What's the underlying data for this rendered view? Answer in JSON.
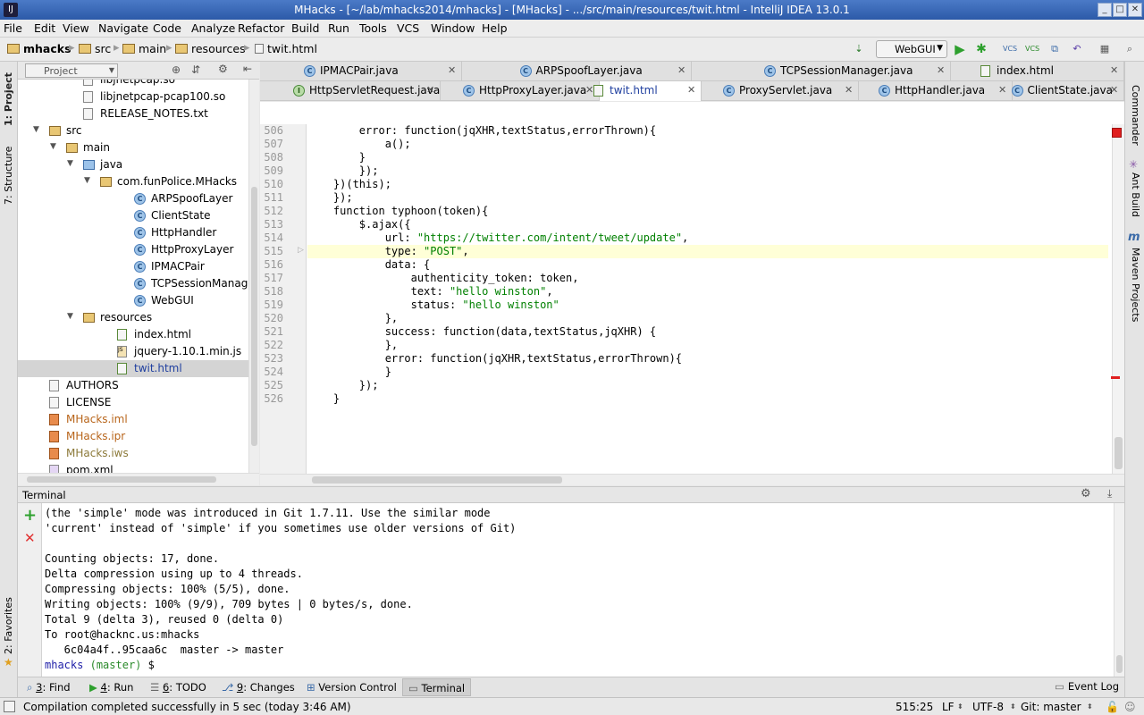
{
  "window": {
    "title": "MHacks - [~/lab/mhacks2014/mhacks] - [MHacks] - .../src/main/resources/twit.html - IntelliJ IDEA 13.0.1"
  },
  "menu": [
    "File",
    "Edit",
    "View",
    "Navigate",
    "Code",
    "Analyze",
    "Refactor",
    "Build",
    "Run",
    "Tools",
    "VCS",
    "Window",
    "Help"
  ],
  "breadcrumbs": [
    "mhacks",
    "src",
    "main",
    "resources",
    "twit.html"
  ],
  "run_config": "WebGUI",
  "left_tools": [
    "1: Project",
    "7: Structure",
    "2: Favorites"
  ],
  "right_tools": [
    "Commander",
    "Ant Build",
    "Maven Projects"
  ],
  "project": {
    "header": "Project",
    "tree": [
      {
        "label": "libjnetpcap.so",
        "indent": 3,
        "icon": "file",
        "arrow": ""
      },
      {
        "label": "libjnetpcap-pcap100.so",
        "indent": 3,
        "icon": "file",
        "arrow": ""
      },
      {
        "label": "RELEASE_NOTES.txt",
        "indent": 3,
        "icon": "file",
        "arrow": ""
      },
      {
        "label": "src",
        "indent": 1,
        "icon": "folder",
        "arrow": "▼"
      },
      {
        "label": "main",
        "indent": 2,
        "icon": "folder",
        "arrow": "▼"
      },
      {
        "label": "java",
        "indent": 3,
        "icon": "folder-blue",
        "arrow": "▼"
      },
      {
        "label": "com.funPolice.MHacks",
        "indent": 4,
        "icon": "package",
        "arrow": "▼"
      },
      {
        "label": "ARPSpoofLayer",
        "indent": 6,
        "icon": "class",
        "arrow": ""
      },
      {
        "label": "ClientState",
        "indent": 6,
        "icon": "class",
        "arrow": ""
      },
      {
        "label": "HttpHandler",
        "indent": 6,
        "icon": "class",
        "arrow": ""
      },
      {
        "label": "HttpProxyLayer",
        "indent": 6,
        "icon": "class",
        "arrow": ""
      },
      {
        "label": "IPMACPair",
        "indent": 6,
        "icon": "class",
        "arrow": ""
      },
      {
        "label": "TCPSessionManager",
        "indent": 6,
        "icon": "class",
        "arrow": ""
      },
      {
        "label": "WebGUI",
        "indent": 6,
        "icon": "class",
        "arrow": ""
      },
      {
        "label": "resources",
        "indent": 3,
        "icon": "folder",
        "arrow": "▼"
      },
      {
        "label": "index.html",
        "indent": 5,
        "icon": "html",
        "arrow": ""
      },
      {
        "label": "jquery-1.10.1.min.js",
        "indent": 5,
        "icon": "js",
        "arrow": ""
      },
      {
        "label": "twit.html",
        "indent": 5,
        "icon": "html",
        "arrow": "",
        "selected": true
      },
      {
        "label": "AUTHORS",
        "indent": 1,
        "icon": "file",
        "arrow": ""
      },
      {
        "label": "LICENSE",
        "indent": 1,
        "icon": "file",
        "arrow": ""
      },
      {
        "label": "MHacks.iml",
        "indent": 1,
        "icon": "git",
        "arrow": "",
        "color": "#b8651b"
      },
      {
        "label": "MHacks.ipr",
        "indent": 1,
        "icon": "git",
        "arrow": "",
        "color": "#b8651b"
      },
      {
        "label": "MHacks.iws",
        "indent": 1,
        "icon": "git",
        "arrow": "",
        "color": "#8c7a3a"
      },
      {
        "label": "pom.xml",
        "indent": 1,
        "icon": "xml",
        "arrow": ""
      }
    ]
  },
  "tabs_row1": [
    {
      "label": "IPMACPair.java",
      "icon": "class"
    },
    {
      "label": "ARPSpoofLayer.java",
      "icon": "class"
    },
    {
      "label": "TCPSessionManager.java",
      "icon": "class"
    },
    {
      "label": "index.html",
      "icon": "html"
    }
  ],
  "tabs_row2": [
    {
      "label": "HttpServletRequest.java",
      "icon": "interface"
    },
    {
      "label": "HttpProxyLayer.java",
      "icon": "class"
    },
    {
      "label": "twit.html",
      "icon": "html",
      "active": true
    },
    {
      "label": "ProxyServlet.java",
      "icon": "class"
    },
    {
      "label": "HttpHandler.java",
      "icon": "class"
    },
    {
      "label": "ClientState.java",
      "icon": "class"
    }
  ],
  "editor": {
    "lines": [
      {
        "n": "506",
        "code": "        error: function(jqXHR,textStatus,errorThrown){"
      },
      {
        "n": "507",
        "code": "            a();"
      },
      {
        "n": "508",
        "code": "        }"
      },
      {
        "n": "509",
        "code": "        });"
      },
      {
        "n": "510",
        "code": "    })(this);"
      },
      {
        "n": "511",
        "code": "    });"
      },
      {
        "n": "512",
        "code": "    function typhoon(token){"
      },
      {
        "n": "513",
        "code": "        $.ajax({"
      },
      {
        "n": "514",
        "code": "            url: \"https://twitter.com/intent/tweet/update\","
      },
      {
        "n": "515",
        "code": "            type: \"POST\",",
        "highlight": true
      },
      {
        "n": "516",
        "code": "            data: {"
      },
      {
        "n": "517",
        "code": "                authenticity_token: token,"
      },
      {
        "n": "518",
        "code": "                text: \"hello winston\","
      },
      {
        "n": "519",
        "code": "                status: \"hello winston\""
      },
      {
        "n": "520",
        "code": "            },"
      },
      {
        "n": "521",
        "code": "            success: function(data,textStatus,jqXHR) {"
      },
      {
        "n": "522",
        "code": "            },"
      },
      {
        "n": "523",
        "code": "            error: function(jqXHR,textStatus,errorThrown){"
      },
      {
        "n": "524",
        "code": "            }"
      },
      {
        "n": "525",
        "code": "        });"
      },
      {
        "n": "526",
        "code": "    }"
      }
    ]
  },
  "terminal": {
    "header": "Terminal",
    "lines": [
      "(the 'simple' mode was introduced in Git 1.7.11. Use the similar mode",
      "'current' instead of 'simple' if you sometimes use older versions of Git)",
      "",
      "Counting objects: 17, done.",
      "Delta compression using up to 4 threads.",
      "Compressing objects: 100% (5/5), done.",
      "Writing objects: 100% (9/9), 709 bytes | 0 bytes/s, done.",
      "Total 9 (delta 3), reused 0 (delta 0)",
      "To root@hacknc.us:mhacks",
      "   6c04a4f..95caa6c  master -> master"
    ],
    "prompt_dir": "mhacks",
    "prompt_branch": "(master)",
    "prompt_symbol": "$"
  },
  "tool_windows": [
    {
      "num": "3",
      "label": ": Find",
      "icon": "search-icon"
    },
    {
      "num": "4",
      "label": ": Run",
      "icon": "run-icon"
    },
    {
      "num": "6",
      "label": ": TODO",
      "icon": "todo-icon"
    },
    {
      "num": "9",
      "label": ": Changes",
      "icon": "changes-icon"
    },
    {
      "num": "",
      "label": "Version Control",
      "icon": "vcs-icon"
    },
    {
      "num": "",
      "label": "Terminal",
      "icon": "terminal-icon",
      "active": true
    }
  ],
  "event_log": "Event Log",
  "status": {
    "message": "Compilation completed successfully in 5 sec (today 3:46 AM)",
    "position": "515:25",
    "line_sep": "LF",
    "encoding": "UTF-8",
    "vcs": "Git: master"
  },
  "colors": {
    "title_bar": "#2c5aa8",
    "string_literal": "#008000",
    "prompt_dir": "#1f1fa8",
    "prompt_branch": "#2a8a2a",
    "highlight_line": "#ffffd7",
    "error_marker": "#e02020"
  }
}
